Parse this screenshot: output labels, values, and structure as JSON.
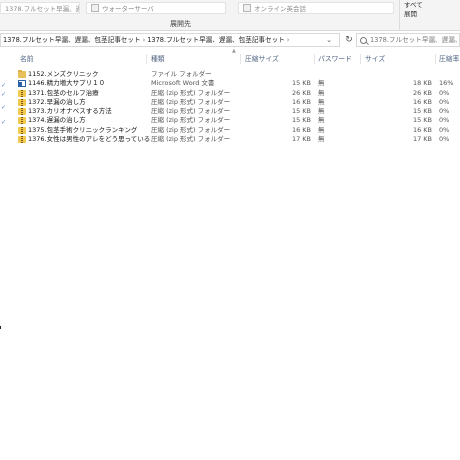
{
  "ribbon": {
    "field1": "1378.フルセット早漏、遅漏、包茎記事セット",
    "field2": "ウォーターサーバ",
    "field3": "オンライン英会話",
    "expand_line1": "すべて",
    "expand_line2": "展開",
    "group_label": "展開先"
  },
  "address": {
    "crumbs": [
      "1378.フルセット早漏、遅漏、包茎記事セット",
      "1378.フルセット早漏、遅漏、包茎記事セット"
    ],
    "separator": "›",
    "dropdown": "⌄",
    "refresh": "↻",
    "search_placeholder": "1378.フルセット早漏、遅漏、包..."
  },
  "columns": {
    "name": "名前",
    "type": "種類",
    "compressed_size": "圧縮サイズ",
    "password": "パスワード",
    "size": "サイズ",
    "ratio": "圧縮率"
  },
  "files": [
    {
      "icon": "folder-icon",
      "name": "1152.メンズクリニック",
      "type": "ファイル フォルダー",
      "csize": "",
      "pw": "",
      "size": "",
      "ratio": ""
    },
    {
      "icon": "word-icon",
      "name": "1146.精力増大サプリ１０",
      "type": "Microsoft Word 文書",
      "csize": "15 KB",
      "pw": "無",
      "size": "18 KB",
      "ratio": "16%"
    },
    {
      "icon": "zip-icon",
      "name": "1371.包茎のセルフ治療",
      "type": "圧縮 (zip 形式) フォルダー",
      "csize": "26 KB",
      "pw": "無",
      "size": "26 KB",
      "ratio": "0%"
    },
    {
      "icon": "zip-icon",
      "name": "1372.早漏の治し方",
      "type": "圧縮 (zip 形式) フォルダー",
      "csize": "16 KB",
      "pw": "無",
      "size": "16 KB",
      "ratio": "0%"
    },
    {
      "icon": "zip-icon",
      "name": "1373.カリオナベスする方法",
      "type": "圧縮 (zip 形式) フォルダー",
      "csize": "15 KB",
      "pw": "無",
      "size": "15 KB",
      "ratio": "0%"
    },
    {
      "icon": "zip-icon",
      "name": "1374.遅漏の治し方",
      "type": "圧縮 (zip 形式) フォルダー",
      "csize": "15 KB",
      "pw": "無",
      "size": "15 KB",
      "ratio": "0%"
    },
    {
      "icon": "zip-icon",
      "name": "1375.包茎手術クリニックランキング",
      "type": "圧縮 (zip 形式) フォルダー",
      "csize": "16 KB",
      "pw": "無",
      "size": "16 KB",
      "ratio": "0%"
    },
    {
      "icon": "zip-icon",
      "name": "1376.女性は男性のアレをどう思っている",
      "type": "圧縮 (zip 形式) フォルダー",
      "csize": "17 KB",
      "pw": "無",
      "size": "17 KB",
      "ratio": "0%"
    }
  ]
}
